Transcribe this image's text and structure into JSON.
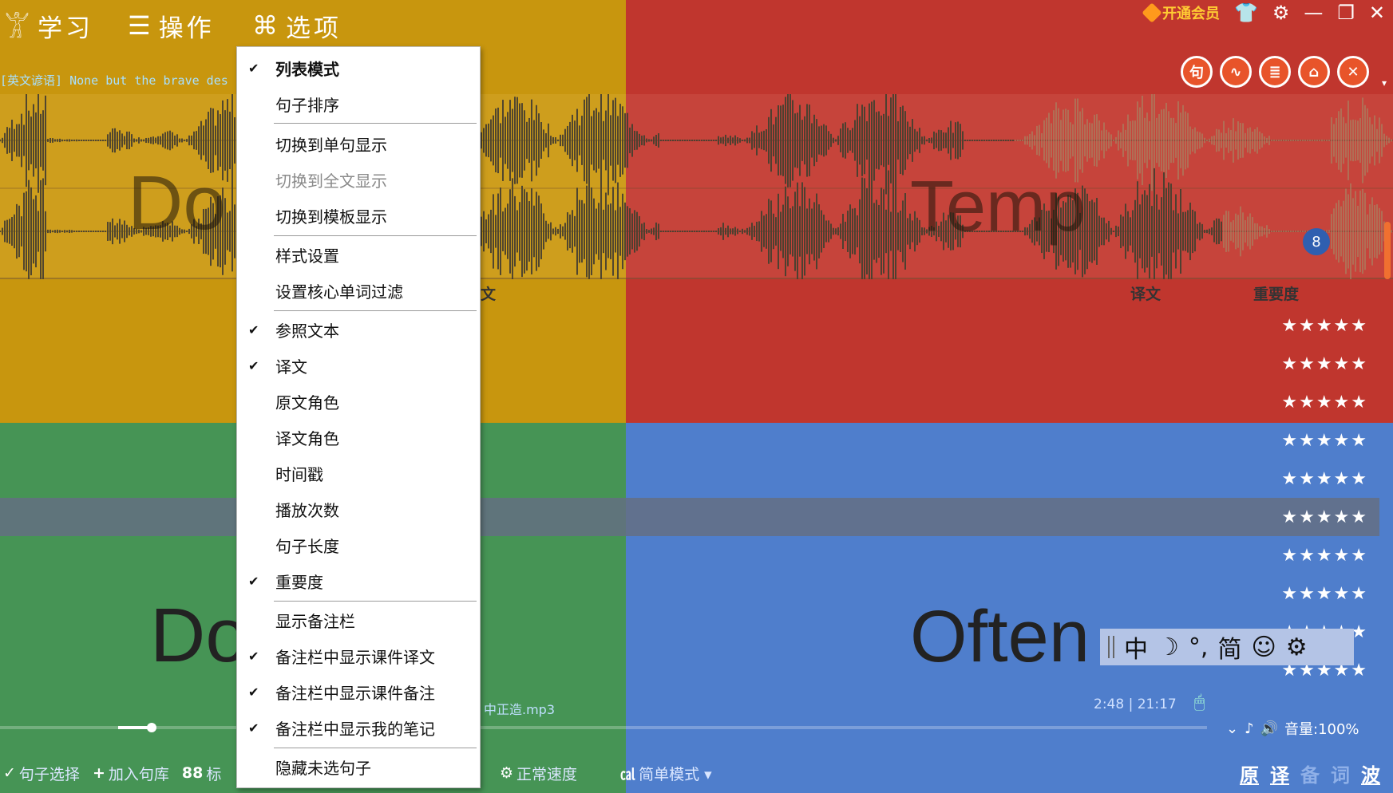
{
  "topbar": {
    "menu": [
      {
        "label": "学习",
        "icon": "learn-icon"
      },
      {
        "label": "操作",
        "icon": "hamburger-icon"
      },
      {
        "label": "选项",
        "icon": "command-icon"
      }
    ],
    "proverb_prefix": "[英文谚语]",
    "proverb_text": "None but the brave des",
    "vip_label": "开通会员"
  },
  "toolbar_circles": [
    {
      "icon": "sentence-icon",
      "glyph": "句"
    },
    {
      "icon": "wave-icon",
      "glyph": "∿"
    },
    {
      "icon": "reader-icon",
      "glyph": "≣"
    },
    {
      "icon": "home-icon",
      "glyph": "⌂"
    },
    {
      "icon": "tools-icon",
      "glyph": "✕"
    }
  ],
  "ghost_text": {
    "top_left": "Do",
    "top_right": "Temp",
    "bottom_left": "Do",
    "bottom_right": "Often"
  },
  "badge_count": "8",
  "columns": {
    "original_partial": "文",
    "translation": "译文",
    "importance": "重要度"
  },
  "rows": [
    {
      "stars": "★★★★★"
    },
    {
      "stars": "★★★★★"
    },
    {
      "stars": "★★★★★"
    },
    {
      "stars": "★★★★★"
    },
    {
      "stars": "★★★★★"
    },
    {
      "stars": "★★★★★",
      "selected": true
    },
    {
      "stars": "★★★★★"
    },
    {
      "stars": "★★★★★"
    },
    {
      "stars": "★★★★★"
    },
    {
      "stars": "★★★★★"
    }
  ],
  "dropdown": {
    "items": [
      {
        "label": "列表模式",
        "checked": true,
        "bold": true
      },
      {
        "label": "句子排序"
      },
      {
        "sep": true
      },
      {
        "label": "切换到单句显示"
      },
      {
        "label": "切换到全文显示",
        "disabled": true
      },
      {
        "label": "切换到模板显示"
      },
      {
        "sep": true
      },
      {
        "label": "样式设置"
      },
      {
        "label": "设置核心单词过滤"
      },
      {
        "sep": true
      },
      {
        "label": "参照文本",
        "checked": true
      },
      {
        "label": "译文",
        "checked": true
      },
      {
        "label": "原文角色"
      },
      {
        "label": "译文角色"
      },
      {
        "label": "时间戳"
      },
      {
        "label": "播放次数"
      },
      {
        "label": "句子长度"
      },
      {
        "label": "重要度",
        "checked": true
      },
      {
        "sep": true
      },
      {
        "label": "显示备注栏"
      },
      {
        "label": "备注栏中显示课件译文",
        "checked": true
      },
      {
        "label": "备注栏中显示课件备注",
        "checked": true
      },
      {
        "label": "备注栏中显示我的笔记",
        "checked": true
      },
      {
        "sep": true
      },
      {
        "label": "隐藏未选句子"
      }
    ]
  },
  "ime": {
    "items": [
      "中",
      "☽",
      "°,",
      "简",
      "☺",
      "⚙"
    ]
  },
  "player": {
    "filename": "中正造.mp3",
    "time": "2:48 | 21:17",
    "volume": "音量:100%",
    "progress_fraction": 0.12
  },
  "bottom_toolbar": {
    "left": [
      {
        "icon": "check-icon",
        "glyph": "✓",
        "label": "句子选择"
      },
      {
        "icon": "plus-icon",
        "glyph": "+",
        "label": "加入句库"
      },
      {
        "icon": "grid-icon",
        "glyph": "88",
        "label": "标"
      }
    ],
    "mid": [
      {
        "icon": "gear-icon",
        "glyph": "⚙",
        "label": "正常速度"
      },
      {
        "icon": "chart-icon",
        "glyph": "㎈",
        "label": "简单模式 ▾"
      }
    ],
    "right_links": [
      {
        "label": "原",
        "dim": false
      },
      {
        "label": "译",
        "dim": false
      },
      {
        "label": "备",
        "dim": true
      },
      {
        "label": "词",
        "dim": true
      },
      {
        "label": "波",
        "dim": false
      }
    ]
  }
}
